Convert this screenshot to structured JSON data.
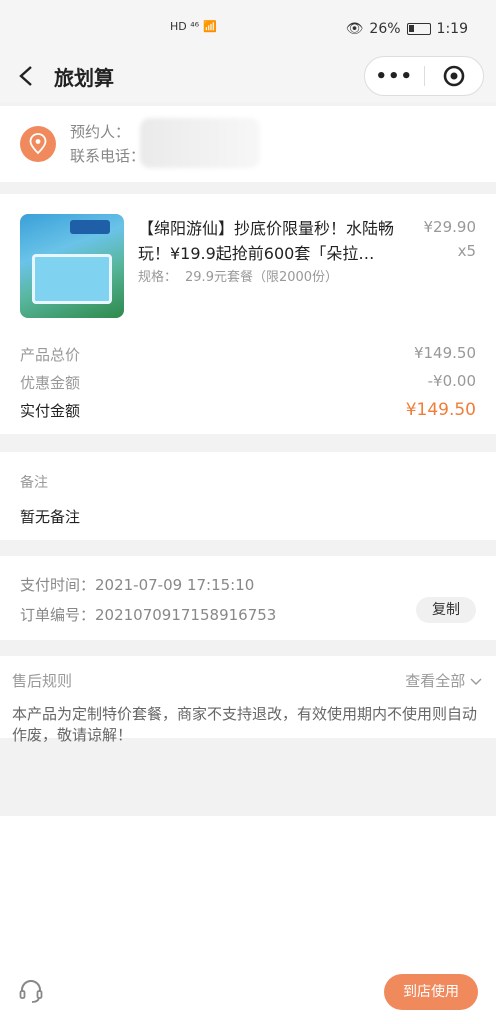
{
  "status": {
    "left": "HD ⁴⁶",
    "battery": "26%",
    "time": "1:19"
  },
  "nav": {
    "title": "旅划算",
    "more": "•••"
  },
  "contact": {
    "booker_label": "预约人：",
    "phone_label": "联系电话："
  },
  "product": {
    "title": "【绵阳游仙】抄底价限量秒！水陆畅玩！¥19.9起抢前600套「朵拉…",
    "price": "¥29.90",
    "qty": "x5",
    "spec_label": "规格：",
    "spec_value": "29.9元套餐（限2000份）"
  },
  "summary": {
    "total_label": "产品总价",
    "total_value": "¥149.50",
    "discount_label": "优惠金额",
    "discount_value": "-¥0.00",
    "paid_label": "实付金额",
    "paid_value": "¥149.50"
  },
  "remark": {
    "title": "备注",
    "text": "暂无备注"
  },
  "info": {
    "pay_time": "支付时间：2021-07-09 17:15:10",
    "order_no": "订单编号：2021070917158916753",
    "copy_label": "复制"
  },
  "aftersale": {
    "title": "售后规则",
    "view_all": "查看全部",
    "text": "本产品为定制特价套餐，商家不支持退改，有效使用期内不使用则自动作废，敬请谅解！"
  },
  "bottom": {
    "use_button": "到店使用"
  },
  "colors": {
    "accent": "#f07d3a",
    "button": "#f08a5d"
  }
}
